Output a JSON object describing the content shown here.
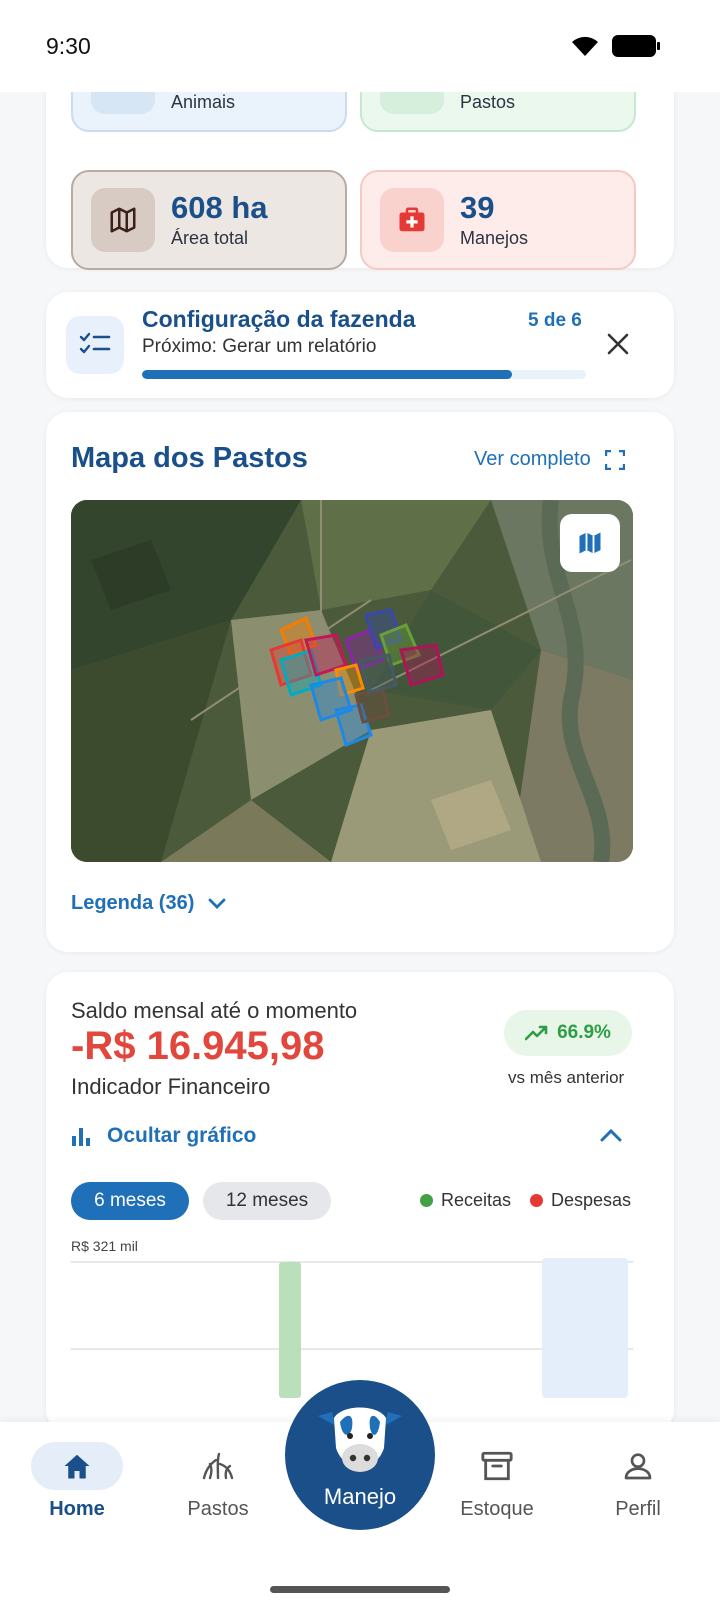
{
  "status_bar": {
    "time": "9:30"
  },
  "summary": {
    "tiles": [
      {
        "value": "",
        "label": "Animais",
        "bg": "#eaf2fb",
        "border": "#c9dcf0"
      },
      {
        "value": "",
        "label": "Pastos",
        "bg": "#eaf8ee",
        "border": "#c6e8cf"
      },
      {
        "value": "608 ha",
        "label": "Área total",
        "bg": "#ede7e3",
        "border": "#b9aaa2",
        "icon": "map-icon"
      },
      {
        "value": "39",
        "label": "Manejos",
        "bg": "#fdecea",
        "border": "#f5c9c4",
        "icon": "first-aid-icon"
      }
    ]
  },
  "setup": {
    "title": "Configuração da fazenda",
    "subtitle": "Próximo: Gerar um relatório",
    "count": "5 de 6",
    "progress": 0.833,
    "icon": "checklist-icon"
  },
  "map": {
    "title": "Mapa dos Pastos",
    "link": "Ver completo",
    "legend": "Legenda (36)"
  },
  "finance": {
    "subtitle": "Saldo mensal até o momento",
    "value": "-R$ 16.945,98",
    "name": "Indicador Financeiro",
    "badge": "66.9%",
    "vs": "vs mês anterior",
    "toggle": "Ocultar gráfico",
    "chip_active": "6 meses",
    "chip_inactive": "12 meses",
    "legend_income": "Receitas",
    "legend_expense": "Despesas",
    "y_max_label": "R$ 321 mil",
    "colors": {
      "income": "#43a047",
      "expense": "#e53935",
      "negative": "#e2473d",
      "positive": "#2e9e44"
    }
  },
  "nav": {
    "home": "Home",
    "pastos": "Pastos",
    "manejo": "Manejo",
    "estoque": "Estoque",
    "perfil": "Perfil"
  },
  "accent": "#1a4f8a"
}
